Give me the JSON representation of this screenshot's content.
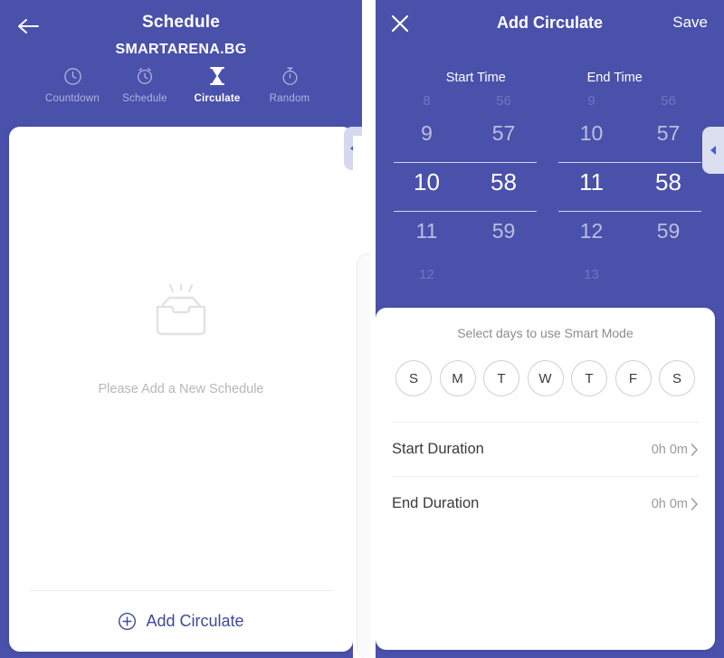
{
  "theme": {
    "bg_indigo": "#4a51ab",
    "card_white": "#ffffff",
    "accent_text": "#3f4a99",
    "muted": "#aeb3dd"
  },
  "left_panel": {
    "back_icon": "arrow-left-icon",
    "title": "Schedule",
    "brand": "SMARTARENA.BG",
    "tabs": [
      {
        "label": "Countdown",
        "icon": "clock-icon",
        "active": false
      },
      {
        "label": "Schedule",
        "icon": "alarm-clock-icon",
        "active": false
      },
      {
        "label": "Circulate",
        "icon": "hourglass-icon",
        "active": true
      },
      {
        "label": "Random",
        "icon": "stopwatch-icon",
        "active": false
      }
    ],
    "empty_state": {
      "icon": "empty-inbox-icon",
      "text": "Please Add a New Schedule"
    },
    "footer": {
      "icon": "plus-circle-icon",
      "label": "Add Circulate"
    },
    "side_handle_icon": "chevron-left-icon"
  },
  "right_panel": {
    "close_icon": "close-icon",
    "title": "Add Circulate",
    "save_label": "Save",
    "side_handle_icon": "chevron-left-icon",
    "pickers": {
      "start": {
        "label": "Start Time",
        "hours": [
          "8",
          "9",
          "10",
          "11",
          "12"
        ],
        "minutes": [
          "56",
          "57",
          "58",
          "59",
          ""
        ],
        "selected_hour": "10",
        "selected_minute": "58"
      },
      "end": {
        "label": "End Time",
        "hours": [
          "9",
          "10",
          "11",
          "12",
          "13"
        ],
        "minutes": [
          "56",
          "57",
          "58",
          "59",
          ""
        ],
        "selected_hour": "11",
        "selected_minute": "58"
      }
    },
    "smart_mode": {
      "title": "Select days to use Smart Mode",
      "days": [
        {
          "letter": "S",
          "selected": false
        },
        {
          "letter": "M",
          "selected": false
        },
        {
          "letter": "T",
          "selected": false
        },
        {
          "letter": "W",
          "selected": false
        },
        {
          "letter": "T",
          "selected": false
        },
        {
          "letter": "F",
          "selected": false
        },
        {
          "letter": "S",
          "selected": false
        }
      ]
    },
    "durations": [
      {
        "label": "Start Duration",
        "value": "0h 0m",
        "chevron": "chevron-right-icon"
      },
      {
        "label": "End Duration",
        "value": "0h 0m",
        "chevron": "chevron-right-icon"
      }
    ]
  }
}
